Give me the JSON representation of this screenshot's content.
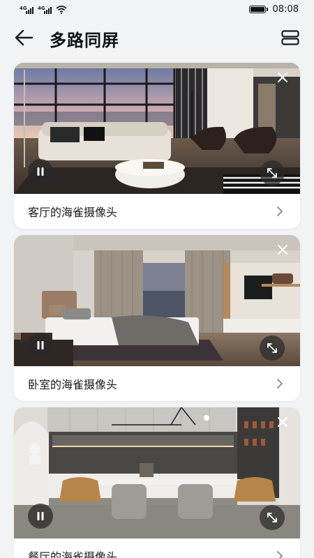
{
  "status_bar": {
    "network_1": "4G",
    "network_2": "4G",
    "time": "08:08",
    "icons": [
      "signal-icon",
      "signal-icon",
      "wifi-icon",
      "battery-icon"
    ]
  },
  "header": {
    "title": "多路同屏",
    "back_icon": "arrow-left-icon",
    "layout_icon": "stacked-layout-icon"
  },
  "cameras": [
    {
      "label": "客厅的海雀摄像头",
      "scene": "living-room"
    },
    {
      "label": "卧室的海雀摄像头",
      "scene": "bedroom"
    },
    {
      "label": "餐厅的海雀摄像头",
      "scene": "dining-room"
    }
  ],
  "colors": {
    "background": "#f1f3f5",
    "card": "#ffffff",
    "text": "#1a1a1a",
    "overlay_button": "#282828"
  }
}
